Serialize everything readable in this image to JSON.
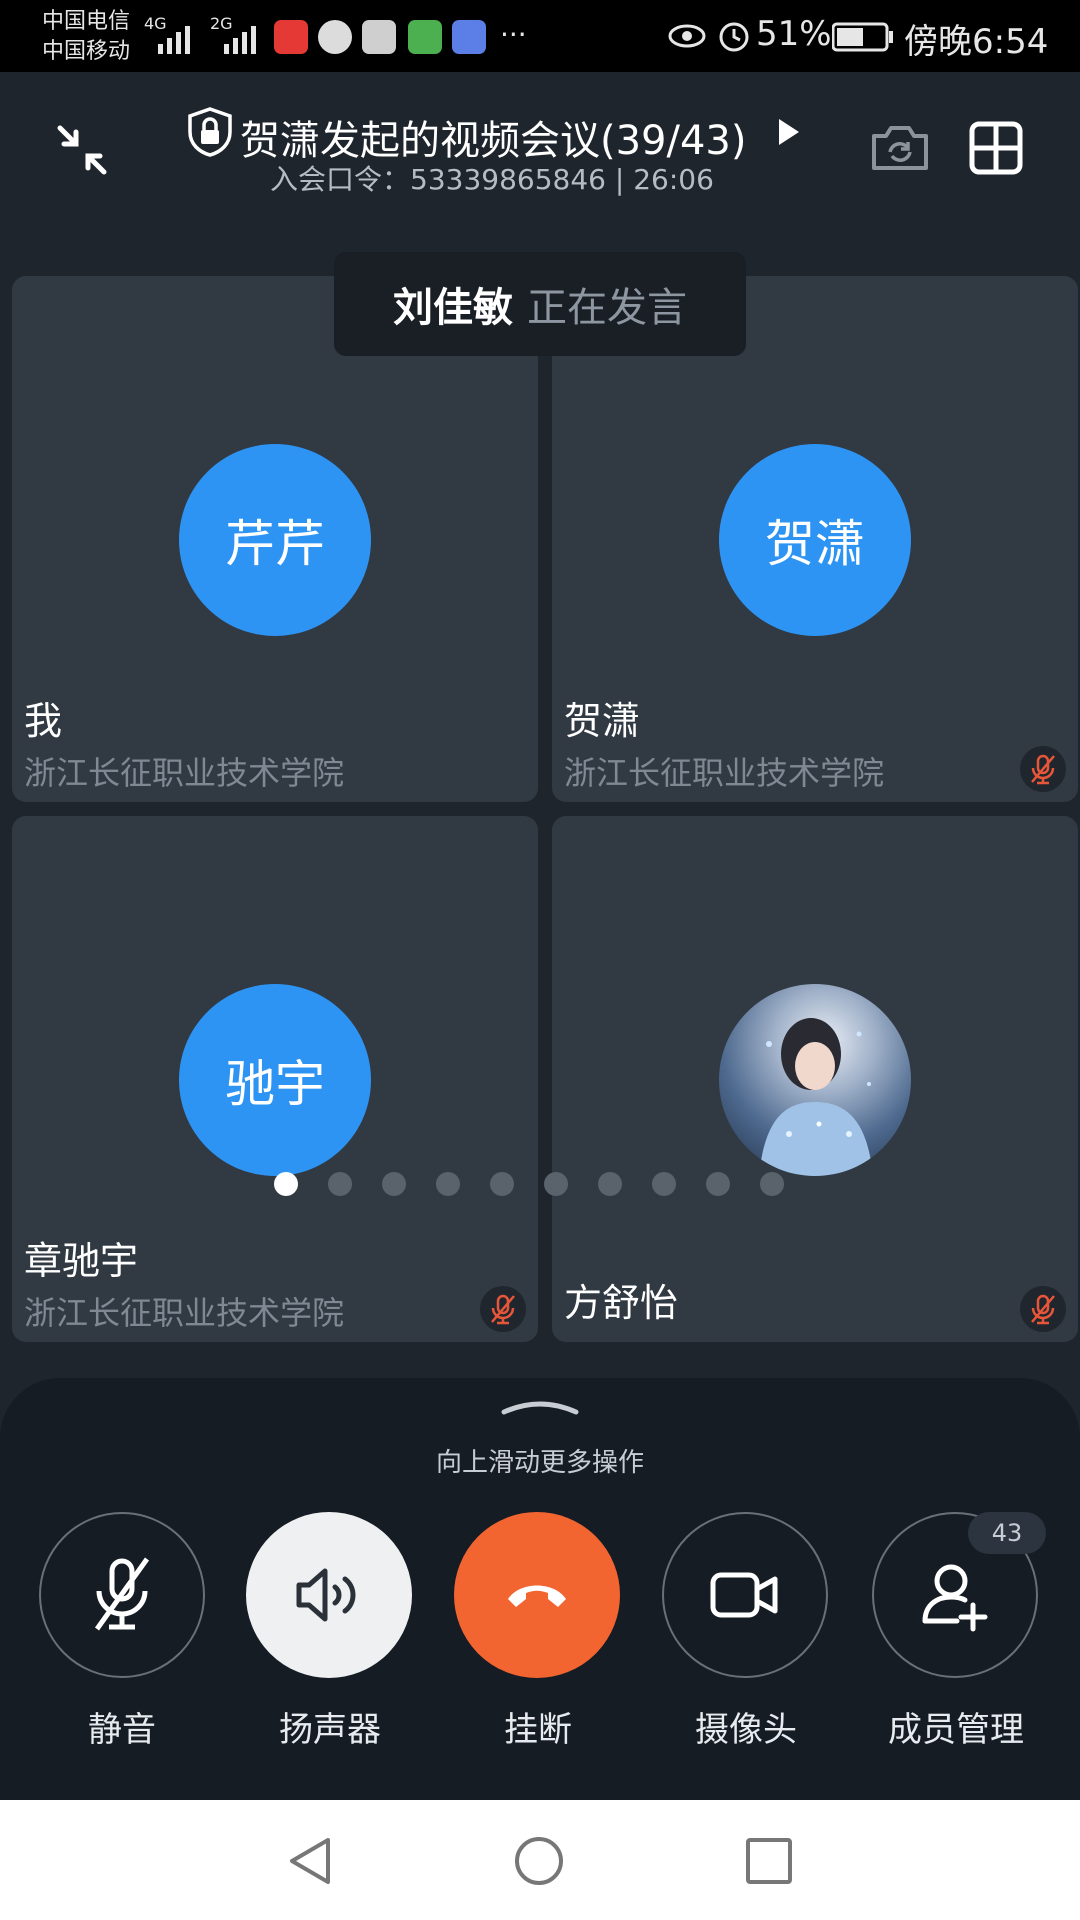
{
  "status_bar": {
    "carrier1": "中国电信",
    "carrier2": "中国移动",
    "net1": "4G",
    "net2": "2G",
    "battery": "51%",
    "time": "傍晚6:54",
    "more": "···"
  },
  "header": {
    "title": "贺潇发起的视频会议(39/43)",
    "subtitle": "入会口令：53339865846 | 26:06"
  },
  "toast": {
    "speaker": "刘佳敏",
    "status": "正在发言"
  },
  "tiles": [
    {
      "avatar_text": "芹芹",
      "name": "我",
      "org": "浙江长征职业技术学院"
    },
    {
      "avatar_text": "贺潇",
      "name": "贺潇",
      "org": "浙江长征职业技术学院"
    },
    {
      "avatar_text": "驰宇",
      "name": "章驰宇",
      "org": "浙江长征职业技术学院"
    },
    {
      "avatar_text": "",
      "name": "方舒怡",
      "org": ""
    }
  ],
  "pager": {
    "count": 10,
    "active": 0
  },
  "sheet": {
    "hint": "向上滑动更多操作",
    "controls": [
      {
        "label": "静音",
        "icon": "mic-off-icon"
      },
      {
        "label": "扬声器",
        "icon": "speaker-icon"
      },
      {
        "label": "挂断",
        "icon": "hangup-icon"
      },
      {
        "label": "摄像头",
        "icon": "camera-icon"
      },
      {
        "label": "成员管理",
        "icon": "add-member-icon"
      }
    ],
    "member_count": "43"
  },
  "colors": {
    "accent_blue": "#2d94f4",
    "hangup_orange": "#f26531",
    "mute_red": "#e8563a"
  }
}
